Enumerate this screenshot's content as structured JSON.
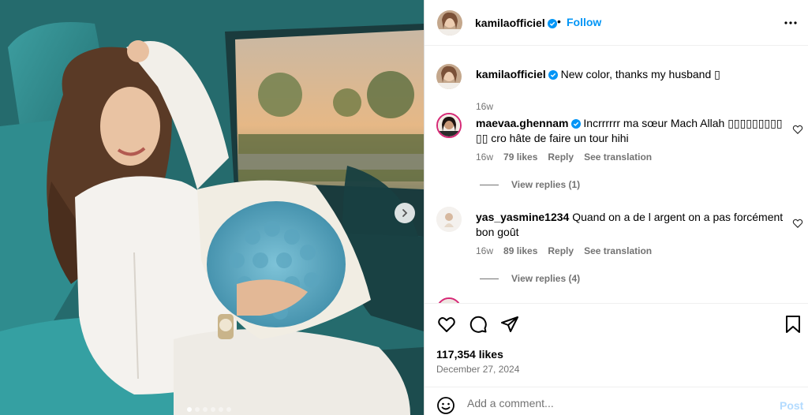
{
  "post": {
    "author": "kamilaofficiel",
    "follow_label": "Follow",
    "separator": "•",
    "more_icon": "more-options-icon",
    "carousel": {
      "slide_count": 6,
      "active_index": 0
    }
  },
  "caption": {
    "author": "kamilaofficiel",
    "text": "New color, thanks my husband ▯",
    "age": "16w"
  },
  "comments": [
    {
      "author": "maevaa.ghennam",
      "verified": true,
      "text": "Incrrrrrr ma sœur Mach Allah ▯▯▯▯▯▯▯▯▯ ▯▯ cro hâte de faire un tour hihi",
      "age": "16w",
      "likes": "79 likes",
      "reply": "Reply",
      "translate": "See translation",
      "view_replies": "View replies (1)"
    },
    {
      "author": "yas_yasmine1234",
      "verified": false,
      "text": "Quand on a de l argent on a pas forcément bon goût",
      "age": "16w",
      "likes": "89 likes",
      "reply": "Reply",
      "translate": "See translation",
      "view_replies": "View replies (4)"
    }
  ],
  "stats": {
    "likes": "117,354 likes",
    "date": "December 27, 2024"
  },
  "composer": {
    "placeholder": "Add a comment...",
    "post_label": "Post"
  },
  "colors": {
    "accent": "#0095f6",
    "verified": "#0095f6",
    "muted": "#737373",
    "post_disabled": "#b3dbff"
  }
}
